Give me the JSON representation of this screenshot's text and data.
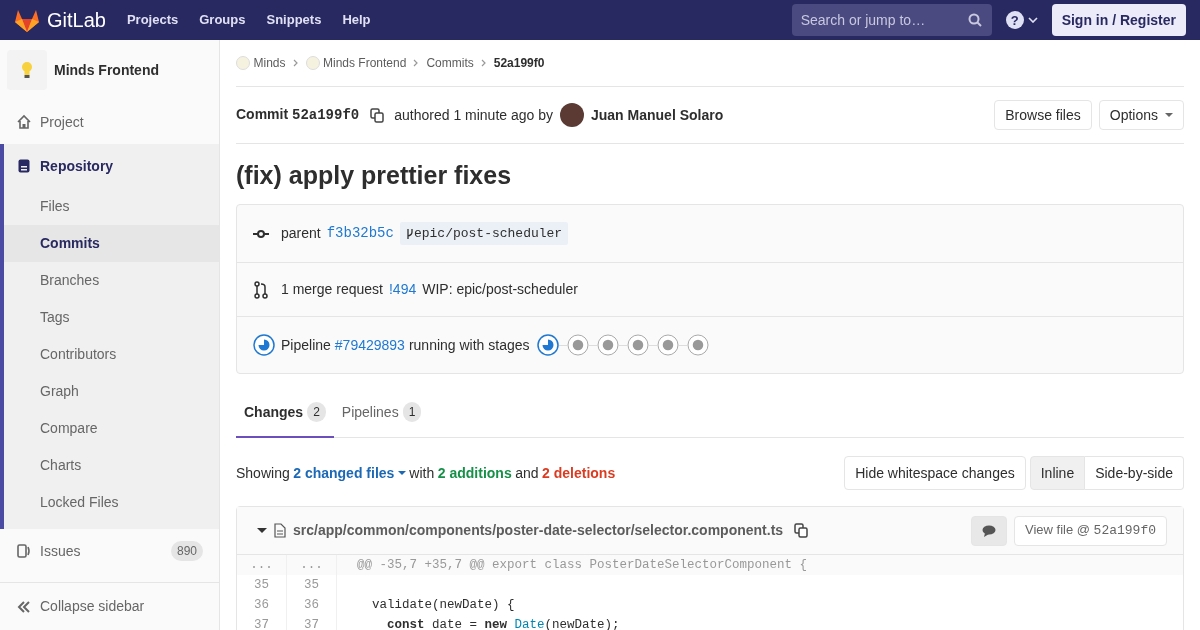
{
  "navbar": {
    "logo_text": "GitLab",
    "links": [
      "Projects",
      "Groups",
      "Snippets",
      "Help"
    ],
    "search": {
      "placeholder": "Search or jump to…"
    },
    "help": "?",
    "sign_in": "Sign in / Register"
  },
  "sidebar": {
    "project_name": "Minds Frontend",
    "items": [
      {
        "kind": "project",
        "label": "Project",
        "selected": false
      },
      {
        "kind": "repository",
        "label": "Repository",
        "selected": true,
        "children": [
          {
            "label": "Files",
            "selected": false
          },
          {
            "label": "Commits",
            "selected": true
          },
          {
            "label": "Branches",
            "selected": false
          },
          {
            "label": "Tags",
            "selected": false
          },
          {
            "label": "Contributors",
            "selected": false
          },
          {
            "label": "Graph",
            "selected": false
          },
          {
            "label": "Compare",
            "selected": false
          },
          {
            "label": "Charts",
            "selected": false
          },
          {
            "label": "Locked Files",
            "selected": false
          }
        ]
      },
      {
        "kind": "issues",
        "label": "Issues",
        "selected": false,
        "badge": "890"
      }
    ],
    "collapse": "Collapse sidebar"
  },
  "breadcrumbs": [
    {
      "label": "Minds",
      "avatar": true
    },
    {
      "label": "Minds Frontend",
      "avatar": true
    },
    {
      "label": "Commits",
      "avatar": false
    },
    {
      "label": "52a199f0",
      "avatar": false,
      "current": true
    }
  ],
  "commit": {
    "label": "Commit",
    "sha": "52a199f0",
    "authored": "authored 1 minute ago by",
    "author": "Juan Manuel Solaro",
    "buttons": [
      {
        "label": "Browse files",
        "caret": false
      },
      {
        "label": "Options",
        "caret": true
      }
    ]
  },
  "title": "(fix) apply prettier fixes",
  "info": {
    "parent_label": "parent",
    "parent_sha": "f3b32b5c",
    "branch": "epic/post-scheduler",
    "mr_label": "1 merge request",
    "mr_link": "!494",
    "mr_title": "WIP: epic/post-scheduler",
    "pipeline_label": "Pipeline",
    "pipeline_link": "#79429893",
    "pipeline_running": true,
    "pipeline_text": "running with stages",
    "stages": [
      {
        "running": true
      },
      {
        "running": false
      },
      {
        "running": false
      },
      {
        "running": false
      },
      {
        "running": false
      },
      {
        "running": false
      }
    ]
  },
  "tabs": [
    {
      "label": "Changes",
      "count": "2",
      "selected": true
    },
    {
      "label": "Pipelines",
      "count": "1",
      "selected": false
    }
  ],
  "stats": {
    "showing": "Showing",
    "files": "2 changed files",
    "with": "with",
    "additions": "2 additions",
    "and": "and",
    "deletions": "2 deletions"
  },
  "view_buttons": [
    {
      "label": "Hide whitespace changes",
      "selected": false,
      "grouped": false
    },
    {
      "label": "Inline",
      "selected": true,
      "grouped": true
    },
    {
      "label": "Side-by-side",
      "selected": false,
      "grouped": true
    }
  ],
  "file": {
    "path": "src/app/common/components/poster-date-selector/selector.component.ts",
    "expanded": true,
    "view_file": "View file @",
    "view_sha": "52a199f0",
    "lines": [
      {
        "kind": "hunk",
        "old": "...",
        "new": "...",
        "tokens": [
          {
            "kind": "plain",
            "text": "@@ -35,7 +35,7 @@ export class PosterDateSelectorComponent {"
          }
        ]
      },
      {
        "kind": "context",
        "old": "35",
        "new": "35"
      },
      {
        "kind": "context",
        "old": "36",
        "new": "36",
        "tokens": [
          {
            "kind": "plain",
            "text": "  validate(newDate) {"
          }
        ]
      },
      {
        "kind": "context",
        "old": "37",
        "new": "37",
        "tokens": [
          {
            "kind": "keyword",
            "text": "    const"
          },
          {
            "kind": "plain",
            "text": " date = "
          },
          {
            "kind": "keyword",
            "text": "new "
          },
          {
            "kind": "type",
            "text": "Date"
          },
          {
            "kind": "plain",
            "text": "(newDate);"
          }
        ]
      }
    ]
  }
}
